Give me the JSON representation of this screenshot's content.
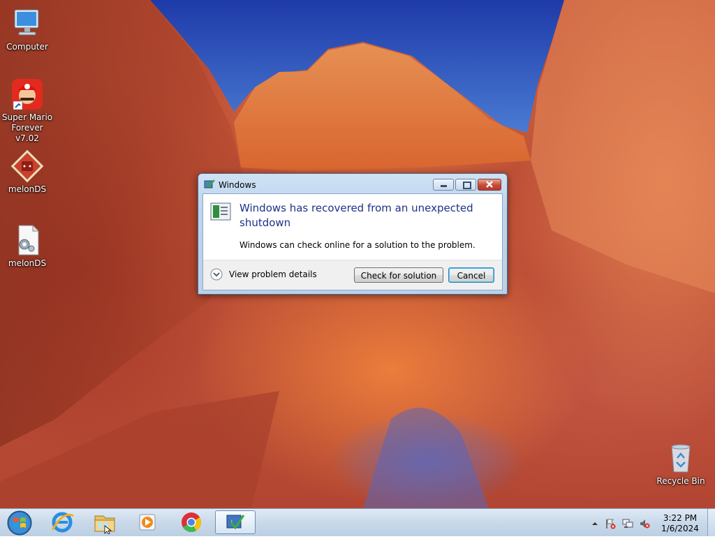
{
  "desktop": {
    "icons": [
      {
        "label": "Computer",
        "icon": "computer-icon"
      },
      {
        "label": "Super Mario\nForever v7.02",
        "icon": "mario-shortcut-icon"
      },
      {
        "label": "melonDS",
        "icon": "melonds-icon"
      },
      {
        "label": "melonDS",
        "icon": "melonds-config-file-icon"
      },
      {
        "label": "Recycle Bin",
        "icon": "recycle-bin-icon"
      }
    ]
  },
  "dialog": {
    "title": "Windows",
    "heading": "Windows has recovered from an unexpected shutdown",
    "message": "Windows can check online for a solution to the problem.",
    "details_label": "View problem details",
    "check_button": "Check for solution",
    "cancel_button": "Cancel",
    "heading_color": "#1e3287"
  },
  "taskbar": {
    "items": [
      {
        "icon": "start-orb-icon"
      },
      {
        "icon": "internet-explorer-icon"
      },
      {
        "icon": "file-explorer-icon"
      },
      {
        "icon": "media-player-icon"
      },
      {
        "icon": "chrome-icon"
      },
      {
        "icon": "action-center-dialog-icon",
        "active": true
      }
    ],
    "tray": [
      "show-hidden-icons-icon",
      "action-center-flag-icon",
      "network-icon",
      "volume-muted-icon"
    ],
    "clock": {
      "time": "3:22 PM",
      "date": "1/6/2024"
    }
  }
}
